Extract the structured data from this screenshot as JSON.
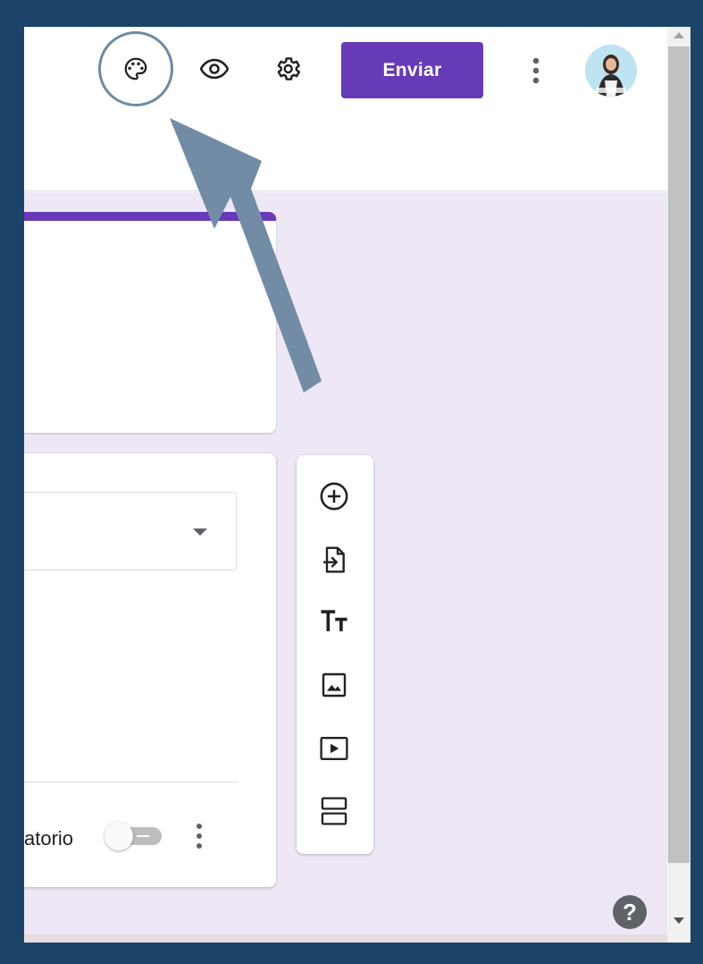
{
  "header": {
    "send_label": "Enviar",
    "icons": [
      "palette-icon",
      "eye-icon",
      "gear-icon",
      "more-vert-icon"
    ],
    "accent_color": "#673ab7"
  },
  "question": {
    "required_label": "atorio",
    "required_on": false
  },
  "sidebar": {
    "icons": [
      "add-question-icon",
      "import-questions-icon",
      "add-title-icon",
      "add-image-icon",
      "add-video-icon",
      "add-section-icon"
    ]
  },
  "help": {
    "label": "?"
  },
  "annotation": {
    "color": "#6e8aa3"
  }
}
